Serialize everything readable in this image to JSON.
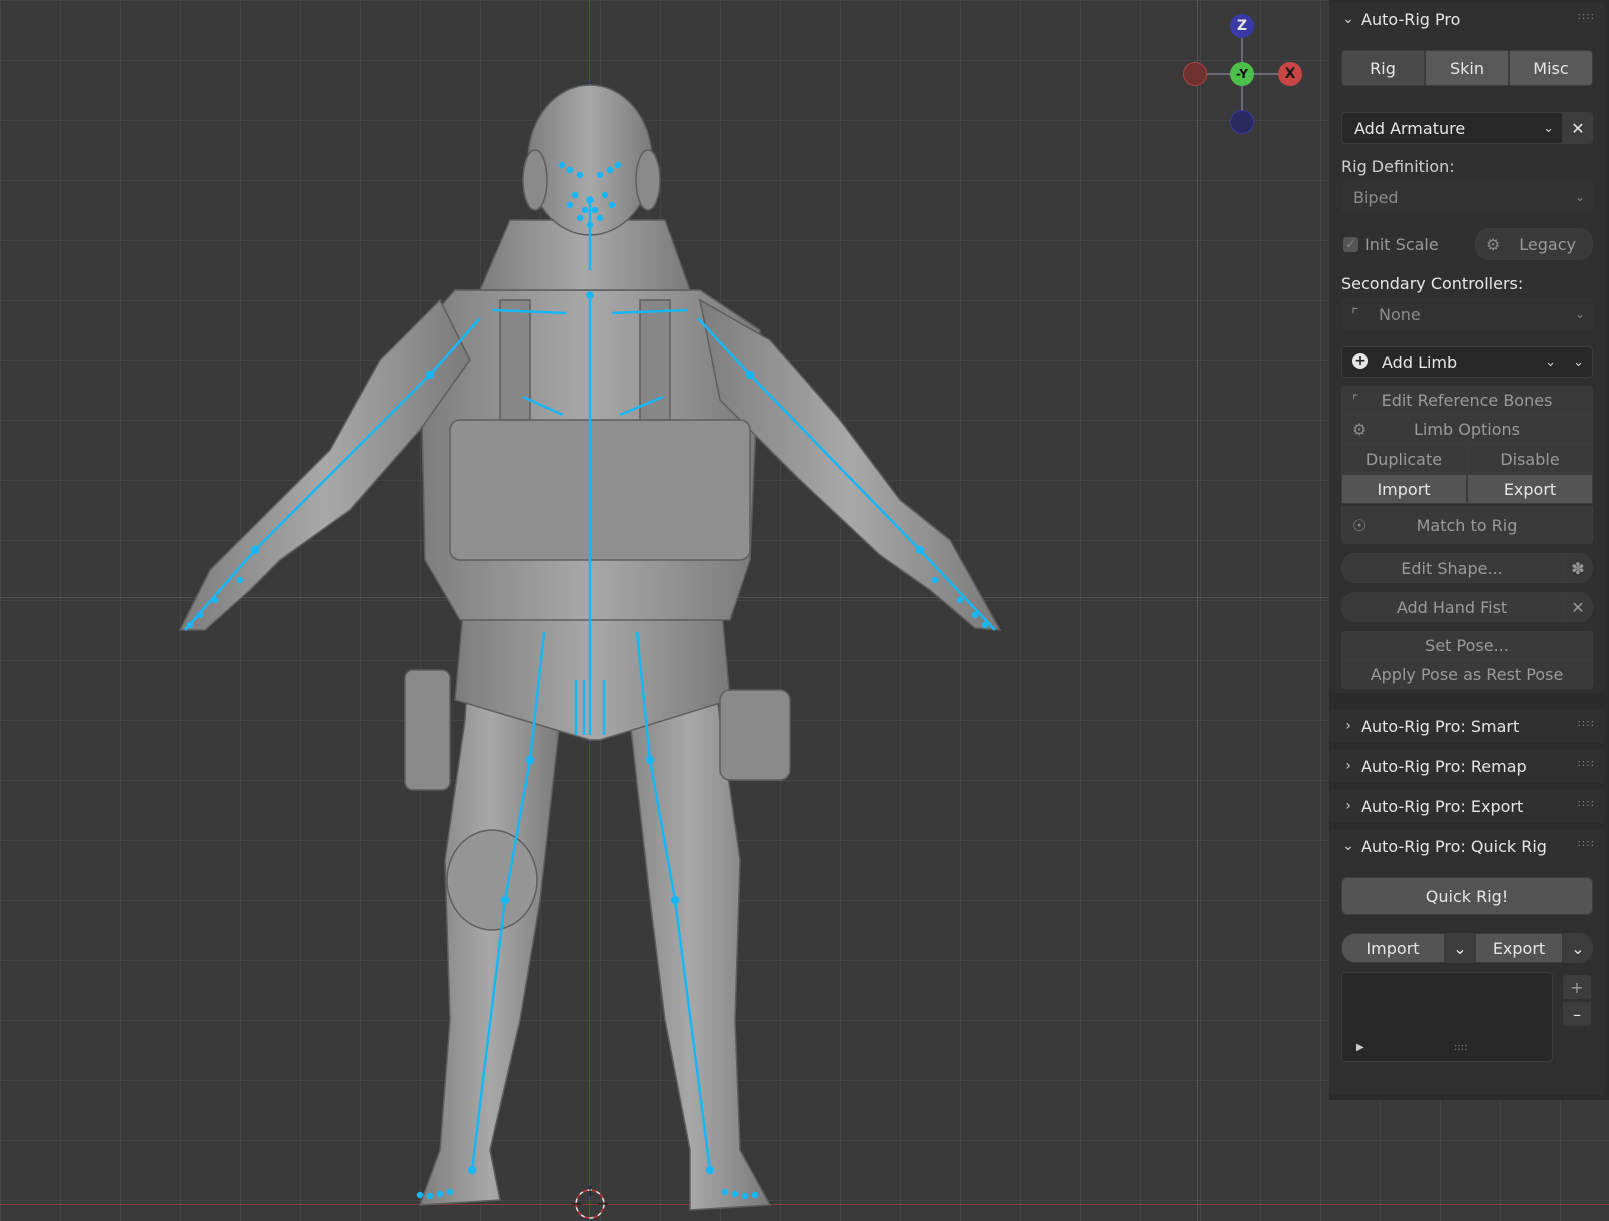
{
  "gizmo": {
    "z": "Z",
    "y": "-Y",
    "x": "X"
  },
  "panel": {
    "title": "Auto-Rig Pro",
    "tabs": [
      "Rig",
      "Skin",
      "Misc"
    ],
    "add_armature": "Add Armature",
    "rig_definition_label": "Rig Definition:",
    "rig_definition_value": "Biped",
    "init_scale": "Init Scale",
    "legacy": "Legacy",
    "secondary_label": "Secondary Controllers:",
    "secondary_value": "None",
    "add_limb": "Add Limb",
    "edit_reference_bones": "Edit Reference Bones",
    "limb_options": "Limb Options",
    "duplicate": "Duplicate",
    "disable": "Disable",
    "import": "Import",
    "export": "Export",
    "match_to_rig": "Match to Rig",
    "edit_shape": "Edit Shape...",
    "add_hand_fist": "Add Hand Fist",
    "set_pose": "Set Pose...",
    "apply_pose": "Apply Pose as Rest Pose"
  },
  "collapsed_panels": [
    {
      "title": "Auto-Rig Pro: Smart"
    },
    {
      "title": "Auto-Rig Pro: Remap"
    },
    {
      "title": "Auto-Rig Pro: Export"
    }
  ],
  "quick_rig": {
    "title": "Auto-Rig Pro: Quick Rig",
    "button": "Quick Rig!",
    "import": "Import",
    "export": "Export"
  },
  "colors": {
    "bone": "#19b6f5",
    "accent": "#4a4a4a"
  }
}
